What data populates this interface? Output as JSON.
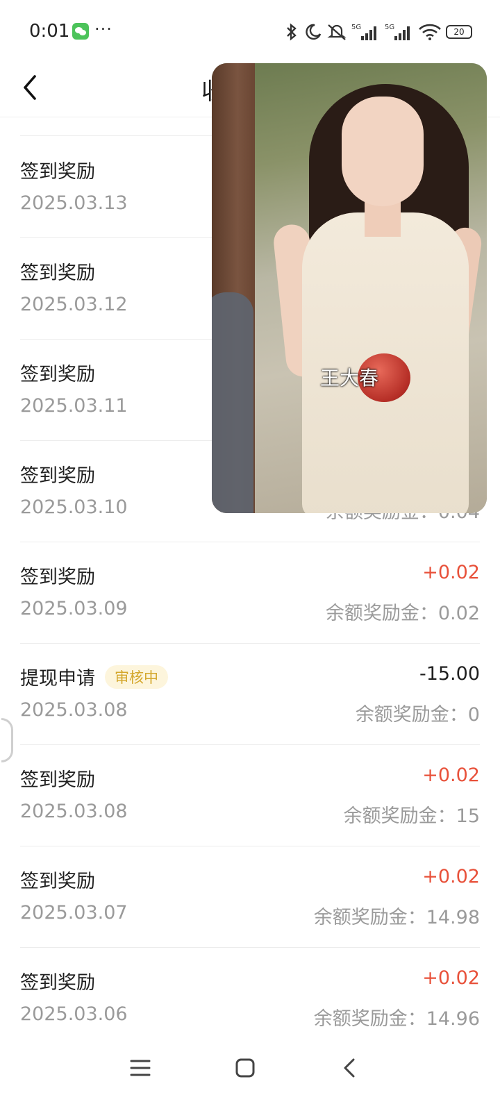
{
  "status_bar": {
    "time": "0:01",
    "more": "···",
    "battery": "20",
    "icons": [
      "wechat-icon",
      "bluetooth-icon",
      "moon-icon",
      "mute-icon",
      "signal-5g-icon",
      "signal-5g-icon",
      "wifi-icon",
      "battery-icon"
    ]
  },
  "header": {
    "title": "收",
    "back_icon": "chevron-left-icon"
  },
  "overlay": {
    "caption": "王大春"
  },
  "records": [
    {
      "title": "签到奖励",
      "date": "2025.03.13",
      "amount": "",
      "balance": ""
    },
    {
      "title": "签到奖励",
      "date": "2025.03.12",
      "amount": "",
      "balance": ""
    },
    {
      "title": "签到奖励",
      "date": "2025.03.11",
      "amount": "",
      "balance": ""
    },
    {
      "title": "签到奖励",
      "date": "2025.03.10",
      "amount": "",
      "balance": "余额奖励金：0.04"
    },
    {
      "title": "签到奖励",
      "date": "2025.03.09",
      "amount": "+0.02",
      "balance": "余额奖励金：0.02"
    },
    {
      "title": "提现申请",
      "badge": "审核中",
      "date": "2025.03.08",
      "amount": "-15.00",
      "balance": "余额奖励金：0"
    },
    {
      "title": "签到奖励",
      "date": "2025.03.08",
      "amount": "+0.02",
      "balance": "余额奖励金：15"
    },
    {
      "title": "签到奖励",
      "date": "2025.03.07",
      "amount": "+0.02",
      "balance": "余额奖励金：14.98"
    },
    {
      "title": "签到奖励",
      "date": "2025.03.06",
      "amount": "+0.02",
      "balance": "余额奖励金：14.96"
    }
  ],
  "nav_bar": {
    "icons": [
      "menu-icon",
      "home-icon",
      "back-icon"
    ]
  },
  "colors": {
    "positive": "#e8513a",
    "muted": "#9a9a9a",
    "badge_text": "#d4a72c",
    "badge_bg": "#fdf5dc",
    "wechat": "#4cc35a"
  }
}
